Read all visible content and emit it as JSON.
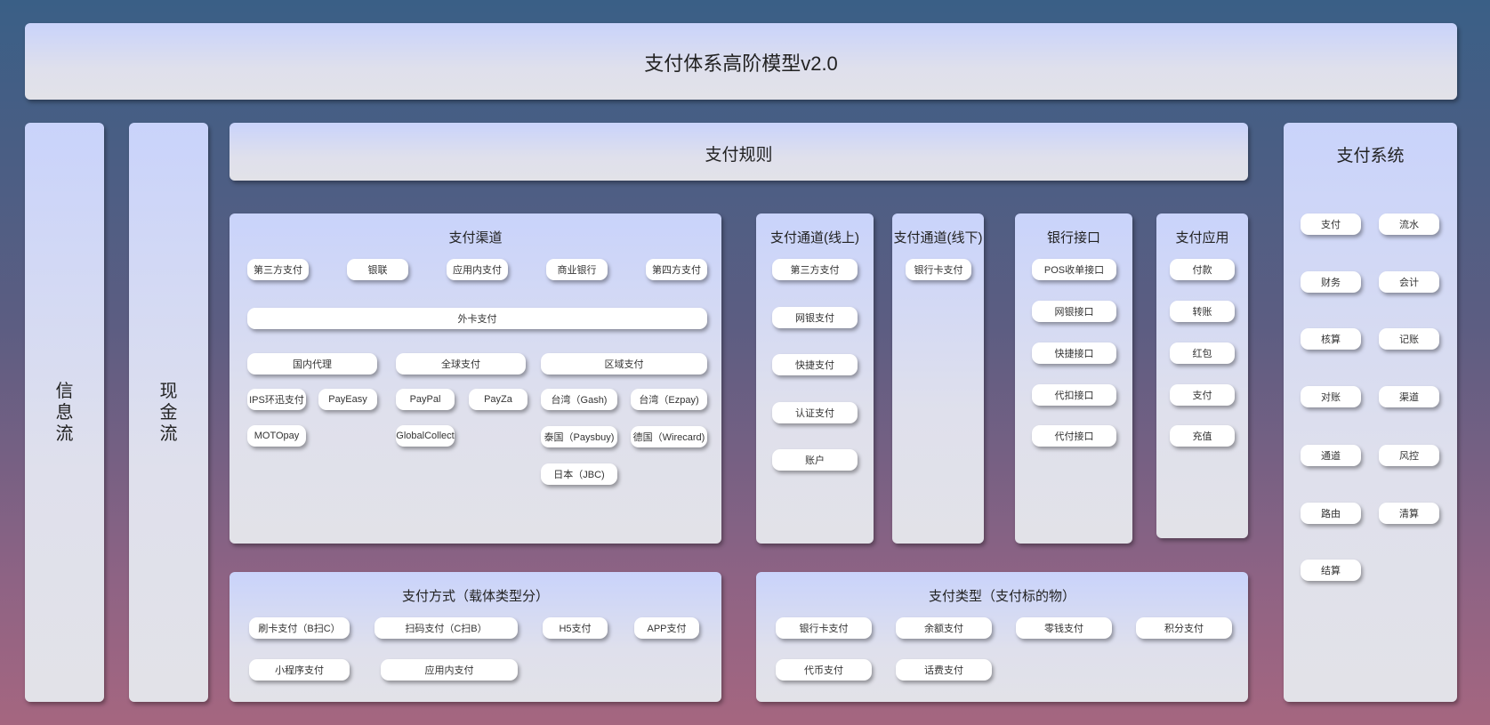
{
  "title": "支付体系高阶模型v2.0",
  "side_left": [
    "信\n息\n流",
    "现\n金\n流"
  ],
  "rules": "支付规则",
  "channels": {
    "title": "支付渠道",
    "row1": [
      "第三方支付",
      "银联",
      "应用内支付",
      "商业银行",
      "第四方支付"
    ],
    "foreign": "外卡支付",
    "groups": [
      "国内代理",
      "全球支付",
      "区域支付"
    ],
    "domestic": [
      "IPS环迅支付",
      "PayEasy",
      "MOTOpay"
    ],
    "global": [
      "PayPal",
      "PayZa",
      "GlobalCollect"
    ],
    "regional": [
      "台湾（Gash)",
      "台湾（Ezpay)",
      "泰国（Paysbuy)",
      "德国（Wirecard)",
      "日本（JBC)"
    ]
  },
  "online": {
    "title": "支付通道(线上)",
    "items": [
      "第三方支付",
      "网银支付",
      "快捷支付",
      "认证支付",
      "账户"
    ]
  },
  "offline": {
    "title": "支付通道(线下)",
    "items": [
      "银行卡支付"
    ]
  },
  "bank": {
    "title": "银行接口",
    "items": [
      "POS收单接口",
      "网银接口",
      "快捷接口",
      "代扣接口",
      "代付接口"
    ]
  },
  "apps": {
    "title": "支付应用",
    "items": [
      "付款",
      "转账",
      "红包",
      "支付",
      "充值"
    ]
  },
  "system": {
    "title": "支付系统",
    "items": [
      "支付",
      "流水",
      "财务",
      "会计",
      "核算",
      "记账",
      "对账",
      "渠道",
      "通道",
      "风控",
      "路由",
      "清算",
      "结算"
    ]
  },
  "methods": {
    "title": "支付方式（载体类型分）",
    "items": [
      "刷卡支付（B扫C）",
      "扫码支付（C扫B）",
      "H5支付",
      "APP支付",
      "小程序支付",
      "应用内支付"
    ]
  },
  "types": {
    "title": "支付类型（支付标的物）",
    "items": [
      "银行卡支付",
      "余额支付",
      "零钱支付",
      "积分支付",
      "代币支付",
      "话费支付"
    ]
  }
}
